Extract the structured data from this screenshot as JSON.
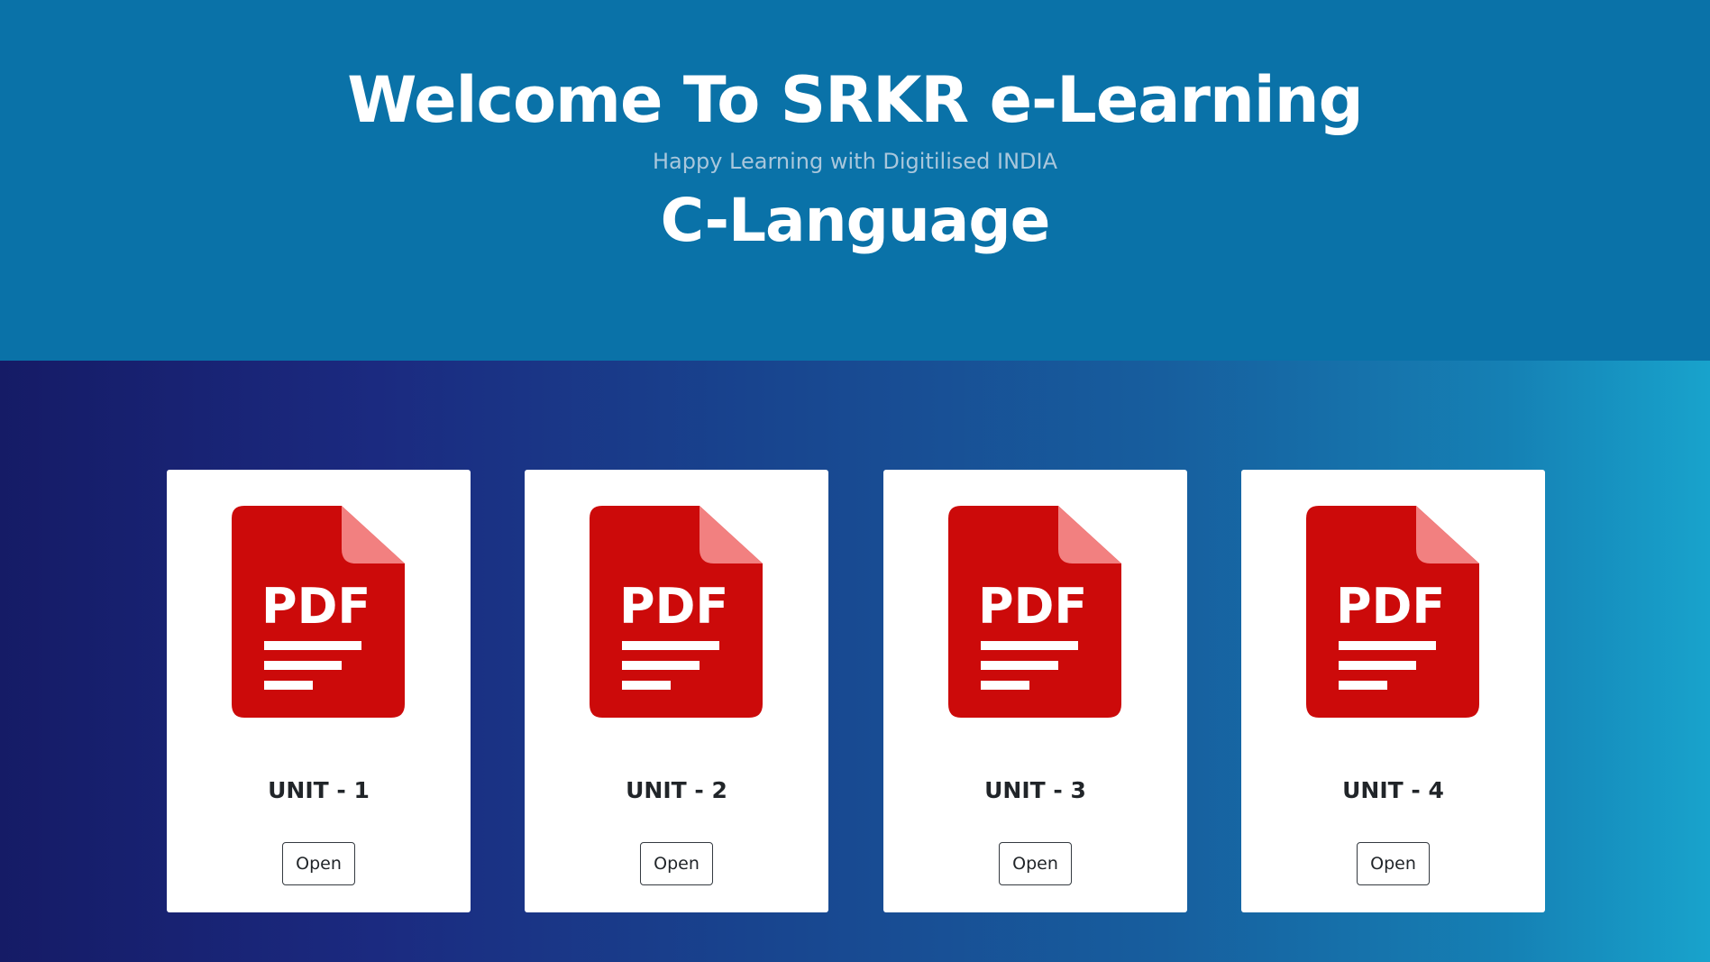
{
  "header": {
    "title": "Welcome To SRKR e-Learning",
    "subtitle": "Happy Learning with Digitilised INDIA",
    "course": "C-Language"
  },
  "colors": {
    "header_bg": "#0a72a8",
    "pdf_red": "#cc0a0a",
    "pdf_fold": "#f28080",
    "card_bg": "#ffffff"
  },
  "cards": [
    {
      "icon": "pdf-file-icon",
      "icon_text": "PDF",
      "label": "UNIT - 1",
      "button": "Open"
    },
    {
      "icon": "pdf-file-icon",
      "icon_text": "PDF",
      "label": "UNIT - 2",
      "button": "Open"
    },
    {
      "icon": "pdf-file-icon",
      "icon_text": "PDF",
      "label": "UNIT - 3",
      "button": "Open"
    },
    {
      "icon": "pdf-file-icon",
      "icon_text": "PDF",
      "label": "UNIT - 4",
      "button": "Open"
    }
  ]
}
